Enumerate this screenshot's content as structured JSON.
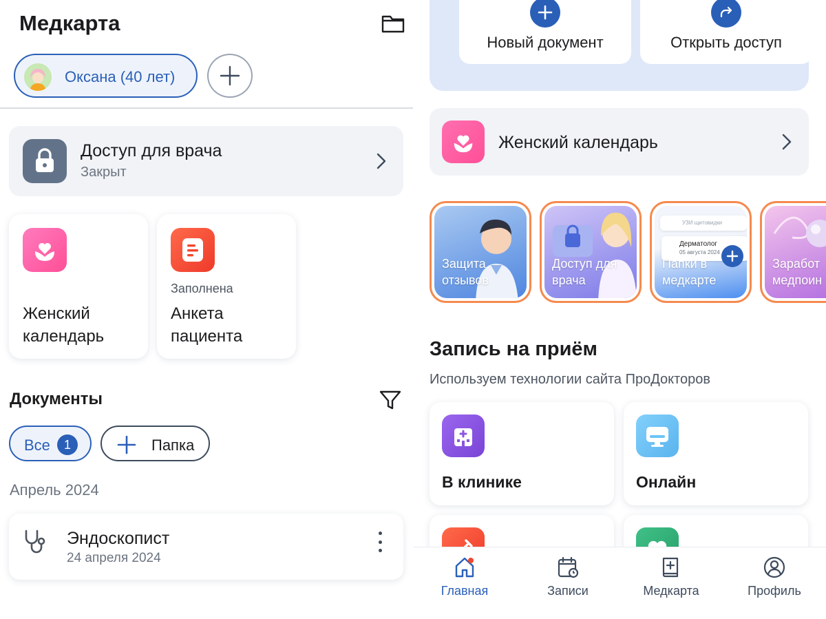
{
  "left": {
    "title": "Медкарта",
    "profile": {
      "name": "Оксана (40 лет)"
    },
    "doctor_access": {
      "title": "Доступ для врача",
      "status": "Закрыт"
    },
    "tiles": [
      {
        "label": "Женский календарь",
        "status": "",
        "icon": "flower-heart-icon",
        "color": "#ff5ea3"
      },
      {
        "label": "Анкета пациента",
        "status": "Заполнена",
        "icon": "form-icon",
        "color": "#f2462e"
      }
    ],
    "documents": {
      "title": "Документы",
      "filter_all": "Все",
      "filter_all_count": "1",
      "add_folder": "Папка",
      "month": "Апрель 2024",
      "items": [
        {
          "title": "Эндоскопист",
          "date": "24 апреля 2024"
        }
      ]
    }
  },
  "right": {
    "actions": [
      {
        "label": "Новый документ",
        "icon": "plus-icon"
      },
      {
        "label": "Открыть доступ",
        "icon": "share-arrow-icon"
      }
    ],
    "women_calendar": {
      "label": "Женский календарь"
    },
    "stories": [
      {
        "line1": "Защита",
        "line2": "отзывов"
      },
      {
        "line1": "Доступ для",
        "line2": "врача"
      },
      {
        "line1": "Папки в",
        "line2": "медкарте"
      },
      {
        "line1": "Заработ",
        "line2": "медпоин"
      }
    ],
    "story_mock": {
      "row1": "УЗИ щитовидки",
      "row2_title": "Дерматолог",
      "row2_date": "05 августа 2024"
    },
    "appointments": {
      "title": "Запись на приём",
      "subtitle": "Используем технологии сайта ПроДокторов",
      "options": [
        {
          "label": "В клинике",
          "icon": "hospital-icon",
          "color": "#8b55e0"
        },
        {
          "label": "Онлайн",
          "icon": "monitor-icon",
          "color": "#6cc3f5"
        },
        {
          "label": "",
          "icon": "syringe-icon",
          "color": "#f2462e"
        },
        {
          "label": "",
          "icon": "heart-icon",
          "color": "#34b07a"
        }
      ]
    },
    "tabbar": [
      {
        "label": "Главная",
        "icon": "home-icon",
        "active": true
      },
      {
        "label": "Записи",
        "icon": "calendar-icon",
        "active": false
      },
      {
        "label": "Медкарта",
        "icon": "medbook-icon",
        "active": false
      },
      {
        "label": "Профиль",
        "icon": "profile-icon",
        "active": false
      }
    ]
  },
  "colors": {
    "accent": "#2a5fb8",
    "pink": "#ff5ea3",
    "story_border": "#f58a4e"
  }
}
